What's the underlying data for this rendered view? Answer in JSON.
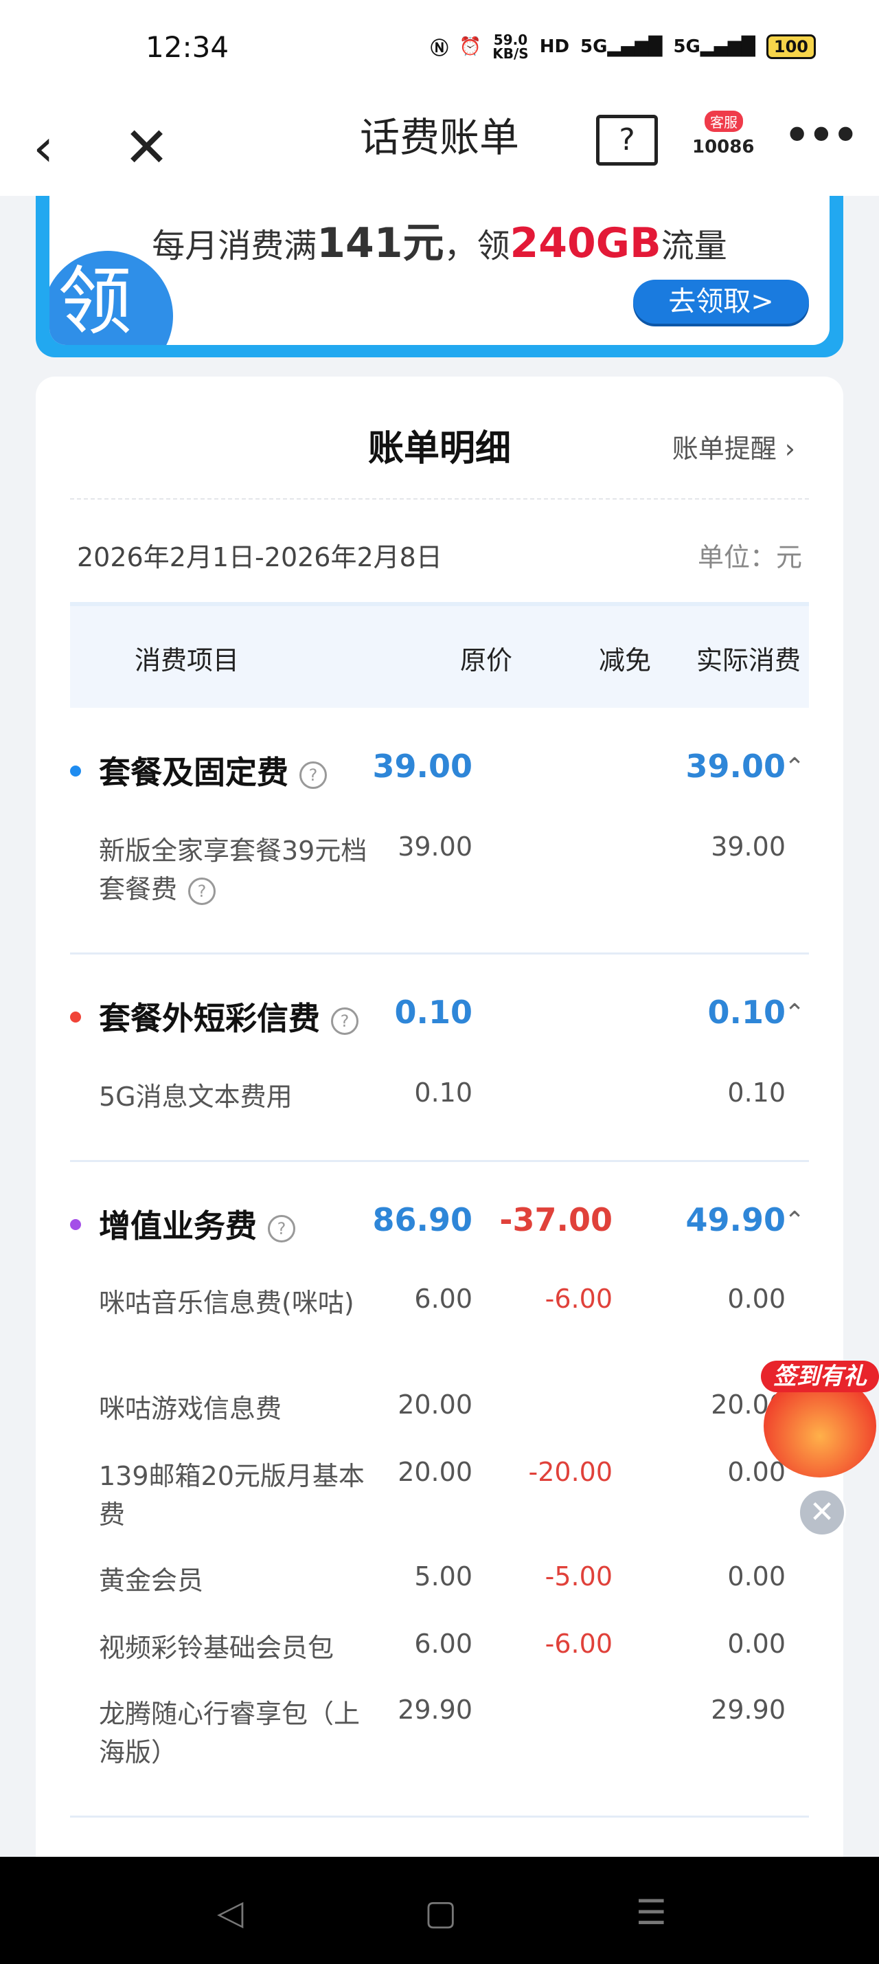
{
  "status_bar": {
    "time": "12:34",
    "net_speed_value": "59.0",
    "net_speed_unit": "KB/S",
    "hd": "HD",
    "net1": "5G",
    "net2": "5G",
    "battery": "100"
  },
  "nav": {
    "title": "话费账单",
    "help": "?",
    "service_badge": "客服",
    "service_number": "10086"
  },
  "banner": {
    "icon_text": "领",
    "promo_prefix": "每月消费满",
    "promo_amount": "141元",
    "promo_mid": "，领",
    "promo_data": "240GB",
    "promo_suffix": "流量",
    "button": "去领取>"
  },
  "bill": {
    "title": "账单明细",
    "reminder": "账单提醒",
    "period": "2026年2月1日-2026年2月8日",
    "unit": "单位：元",
    "headers": {
      "item": "消费项目",
      "original": "原价",
      "discount": "减免",
      "actual": "实际消费"
    },
    "sections": [
      {
        "name": "套餐及固定费",
        "dot_color": "#1f8cf0",
        "original": "39.00",
        "discount": "",
        "actual": "39.00",
        "items": [
          {
            "name": "新版全家享套餐39元档套餐费",
            "original": "39.00",
            "discount": "",
            "actual": "39.00"
          }
        ]
      },
      {
        "name": "套餐外短彩信费",
        "dot_color": "#f04438",
        "original": "0.10",
        "discount": "",
        "actual": "0.10",
        "items": [
          {
            "name": "5G消息文本费用",
            "original": "0.10",
            "discount": "",
            "actual": "0.10"
          }
        ]
      },
      {
        "name": "增值业务费",
        "dot_color": "#a44ee8",
        "original": "86.90",
        "discount": "-37.00",
        "actual": "49.90",
        "items": [
          {
            "name": "咪咕音乐信息费(咪咕)",
            "original": "6.00",
            "discount": "-6.00",
            "actual": "0.00"
          },
          {
            "name": "咪咕游戏信息费",
            "original": "20.00",
            "discount": "",
            "actual": "20.00"
          },
          {
            "name": "139邮箱20元版月基本费",
            "original": "20.00",
            "discount": "-20.00",
            "actual": "0.00"
          },
          {
            "name": "黄金会员",
            "original": "5.00",
            "discount": "-5.00",
            "actual": "0.00"
          },
          {
            "name": "视频彩铃基础会员包",
            "original": "6.00",
            "discount": "-6.00",
            "actual": "0.00"
          },
          {
            "name": "龙腾随心行睿享包（上海版）",
            "original": "29.90",
            "discount": "",
            "actual": "29.90"
          }
        ]
      }
    ]
  },
  "float_sign_in": {
    "label": "签到有礼"
  }
}
